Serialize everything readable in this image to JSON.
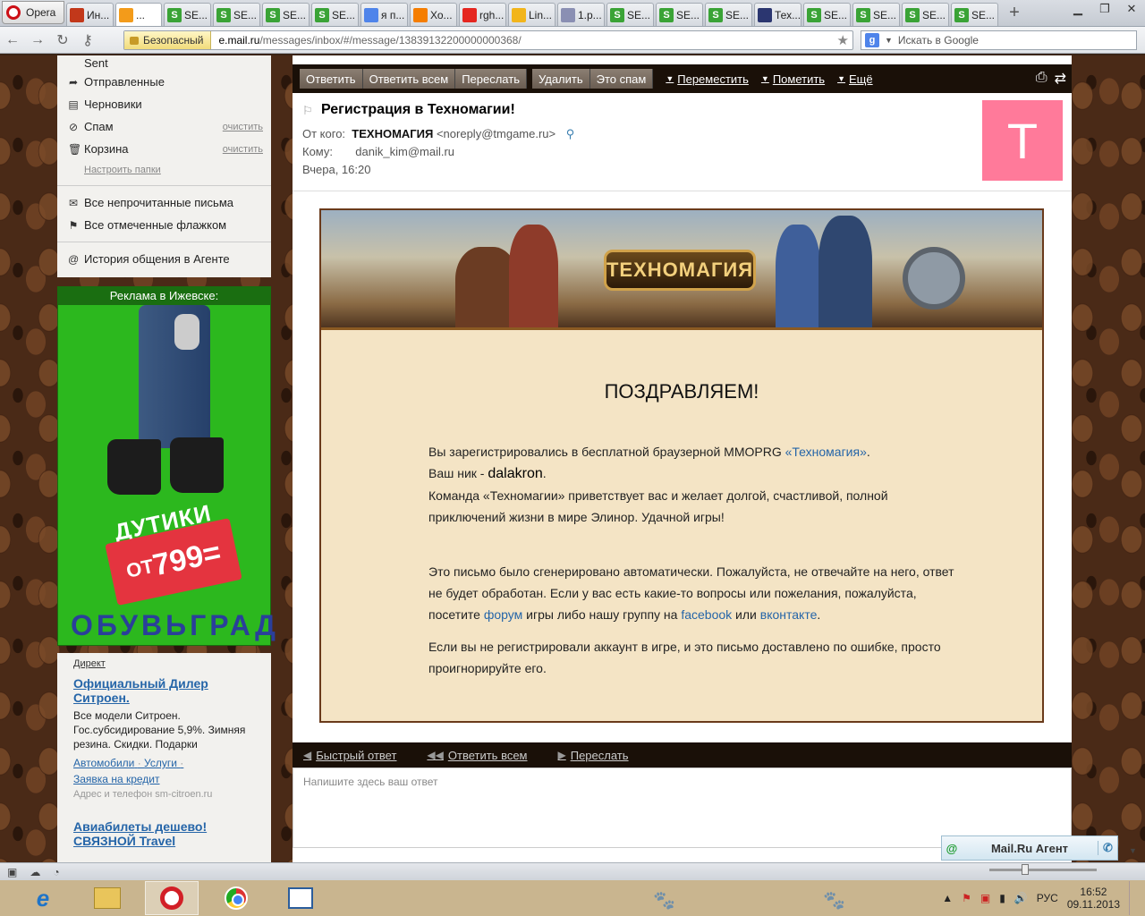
{
  "browser": {
    "menu_label": "Opera",
    "tabs": [
      {
        "label": "Ин...",
        "icon": "kinopoisk-icon",
        "color": "#c2381a"
      },
      {
        "label": "...",
        "icon": "mailru-icon",
        "color": "#f39b1a",
        "active": true
      },
      {
        "label": "SE...",
        "icon": "seo-icon",
        "color": "#3aa336"
      },
      {
        "label": "SE...",
        "icon": "seo-icon",
        "color": "#3aa336"
      },
      {
        "label": "SE...",
        "icon": "seo-icon",
        "color": "#3aa336"
      },
      {
        "label": "SE...",
        "icon": "seo-icon",
        "color": "#3aa336"
      },
      {
        "label": "я п...",
        "icon": "google-icon",
        "color": "#4f84ea"
      },
      {
        "label": "Хо...",
        "icon": "blogger-icon",
        "color": "#f57d00"
      },
      {
        "label": "rgh...",
        "icon": "yandex-icon",
        "color": "#e52620"
      },
      {
        "label": "Lin...",
        "icon": "flower-icon",
        "color": "#f2b51b"
      },
      {
        "label": "1.p...",
        "icon": "ghost-icon",
        "color": "#8a8fb3"
      },
      {
        "label": "SE...",
        "icon": "seo-icon",
        "color": "#3aa336"
      },
      {
        "label": "SE...",
        "icon": "seo-icon",
        "color": "#3aa336"
      },
      {
        "label": "SE...",
        "icon": "seo-icon",
        "color": "#3aa336"
      },
      {
        "label": "Тех...",
        "icon": "wizard-hat-icon",
        "color": "#2b3670"
      },
      {
        "label": "SE...",
        "icon": "seo-icon",
        "color": "#3aa336"
      },
      {
        "label": "SE...",
        "icon": "seo-icon",
        "color": "#3aa336"
      },
      {
        "label": "SE...",
        "icon": "seo-icon",
        "color": "#3aa336"
      },
      {
        "label": "SE...",
        "icon": "seo-icon",
        "color": "#3aa336"
      }
    ],
    "secure_label": "Безопасный",
    "url_host": "e.mail.ru",
    "url_path": "/messages/inbox/#/message/13839132200000000368/",
    "search_placeholder": "Искать в Google"
  },
  "sidebar": {
    "folders": [
      {
        "label": "Sent",
        "icon": "sent-icon",
        "glyph": "",
        "clear": ""
      },
      {
        "label": "Отправленные",
        "icon": "sent-arrow-icon",
        "glyph": "➦",
        "clear": ""
      },
      {
        "label": "Черновики",
        "icon": "draft-icon",
        "glyph": "▤",
        "clear": ""
      },
      {
        "label": "Спам",
        "icon": "spam-icon",
        "glyph": "⊘",
        "clear": "очистить"
      },
      {
        "label": "Корзина",
        "icon": "trash-icon",
        "glyph": "🗑",
        "clear": "очистить"
      }
    ],
    "setup_link": "Настроить папки",
    "filters": [
      {
        "label": "Все непрочитанные письма",
        "icon": "unread-mail-icon",
        "glyph": "✉"
      },
      {
        "label": "Все отмеченные флажком",
        "icon": "flag-icon",
        "glyph": "⚑"
      }
    ],
    "agent_history": "История общения в Агенте"
  },
  "ad": {
    "title": "Реклама в Ижевске:",
    "product": "ДУТИКИ",
    "price_prefix": "ОТ",
    "price": "799=",
    "brand": "ОБУВЬГРАД"
  },
  "direct": {
    "label": "Директ",
    "ad1": {
      "headline": "Официальный Дилер Ситроен.",
      "text": "Все модели Ситроен. Гос.субсидирование 5,9%. Зимняя резина. Скидки. Подарки",
      "link1": "Автомобили",
      "link2": "Услуги",
      "link3": "Заявка на кредит",
      "site": "Адрес и телефон  sm-citroen.ru"
    },
    "ad2": {
      "headline": "Авиабилеты дешево! СВЯЗНОЙ Travel"
    }
  },
  "toolbar": {
    "reply": "Ответить",
    "reply_all": "Ответить всем",
    "forward": "Переслать",
    "delete": "Удалить",
    "spam": "Это спам",
    "move": "Переместить",
    "mark": "Пометить",
    "more": "Ещё"
  },
  "message": {
    "subject": "Регистрация в Техномагии!",
    "from_label": "От кого:",
    "from_name": "ТЕХНОМАГИЯ",
    "from_email": "<noreply@tmgame.ru>",
    "to_label": "Кому:",
    "to": "danik_kim@mail.ru",
    "date": "Вчера, 16:20",
    "avatar_letter": "T",
    "avatar_color": "#ff7a9a"
  },
  "letter": {
    "logo": "ТЕХНОМАГИЯ",
    "heading": "ПОЗДРАВЛЯЕМ!",
    "p1_text": "Вы зарегистрировались в бесплатной браузерной MMOPRG ",
    "p1_link": "«Техномагия»",
    "nick_prefix": "Ваш ник - ",
    "nick": "dalakron",
    "p2": "Команда «Техномагии» приветствует вас и желает долгой, счастливой, полной приключений жизни в мире Элинор. Удачной игры!",
    "p3_a": "Это письмо было сгенерировано автоматически. Пожалуйста, не отвечайте на него, ответ не будет обработан. Если у вас есть какие-то вопросы или пожелания, пожалуйста, посетите ",
    "p3_forum": "форум",
    "p3_b": " игры либо нашу группу на ",
    "p3_fb": "facebook",
    "p3_c": " или ",
    "p3_vk": "вконтакте",
    "p4": "Если вы не регистрировали аккаунт в игре, и это письмо доставлено по ошибке, просто проигнорируйте его."
  },
  "quick": {
    "quick_reply": "Быстрый ответ",
    "reply_all": "Ответить всем",
    "forward": "Переслать",
    "placeholder": "Напишите здесь ваш ответ"
  },
  "agent": {
    "label": "Mail.Ru Агент"
  },
  "taskbar": {
    "lang": "РУС",
    "time": "16:52",
    "date": "09.11.2013"
  }
}
